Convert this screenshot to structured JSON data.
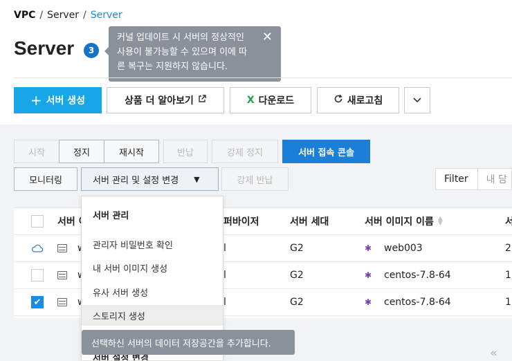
{
  "breadcrumb": {
    "root": "VPC",
    "parent": "Server",
    "current": "Server"
  },
  "page": {
    "title": "Server",
    "count": "3"
  },
  "tooltip_top": {
    "text": "커널 업데이트 시 서버의 정상적인 사용이 불가능할 수 있으며 이에 따른 복구는 지원하지 않습니다.",
    "close_icon": "close-icon"
  },
  "toolbar": {
    "create": "서버 생성",
    "learn_more": "상품 더 알아보기",
    "download": "다운로드",
    "refresh": "새로고침"
  },
  "actions_row1": {
    "start": "시작",
    "stop": "정지",
    "restart": "재시작",
    "return": "반납",
    "force_stop": "강제 정지",
    "console": "서버 접속 콘솔"
  },
  "actions_row2": {
    "monitoring": "모니터링",
    "manage": "서버 관리 및 설정 변경",
    "force_return": "강제 반납"
  },
  "filter": {
    "label": "Filter",
    "placeholder": "내 담"
  },
  "table": {
    "headers": {
      "name": "서버 이",
      "hypervisor": "퍼바이저",
      "generation": "서버 세대",
      "image": "서버 이미지 이름",
      "next": "서"
    },
    "rows": [
      {
        "name": "w",
        "hypervisor": "l",
        "generation": "G2",
        "image": "web003",
        "next": "2"
      },
      {
        "name": "w",
        "hypervisor": "l",
        "generation": "G2",
        "image": "centos-7.8-64",
        "next": "1"
      },
      {
        "name": "w",
        "hypervisor": "l",
        "generation": "G2",
        "image": "centos-7.8-64",
        "next": "1"
      }
    ]
  },
  "dropdown": {
    "group1": "서버 관리",
    "items": [
      "관리자 비밀번호 확인",
      "내 서버 이미지 생성",
      "유사 서버 생성",
      "스토리지 생성"
    ],
    "group2": "서버 설정 변경"
  },
  "tooltip_bottom": {
    "text": "선택하신 서버의 데이터 저장공간을 추가합니다."
  },
  "pager": {
    "prev": "«"
  },
  "colors": {
    "primary": "#17a6e8",
    "console": "#1b7fd8",
    "badge": "#1573c9",
    "tooltip": "#8a919b"
  }
}
